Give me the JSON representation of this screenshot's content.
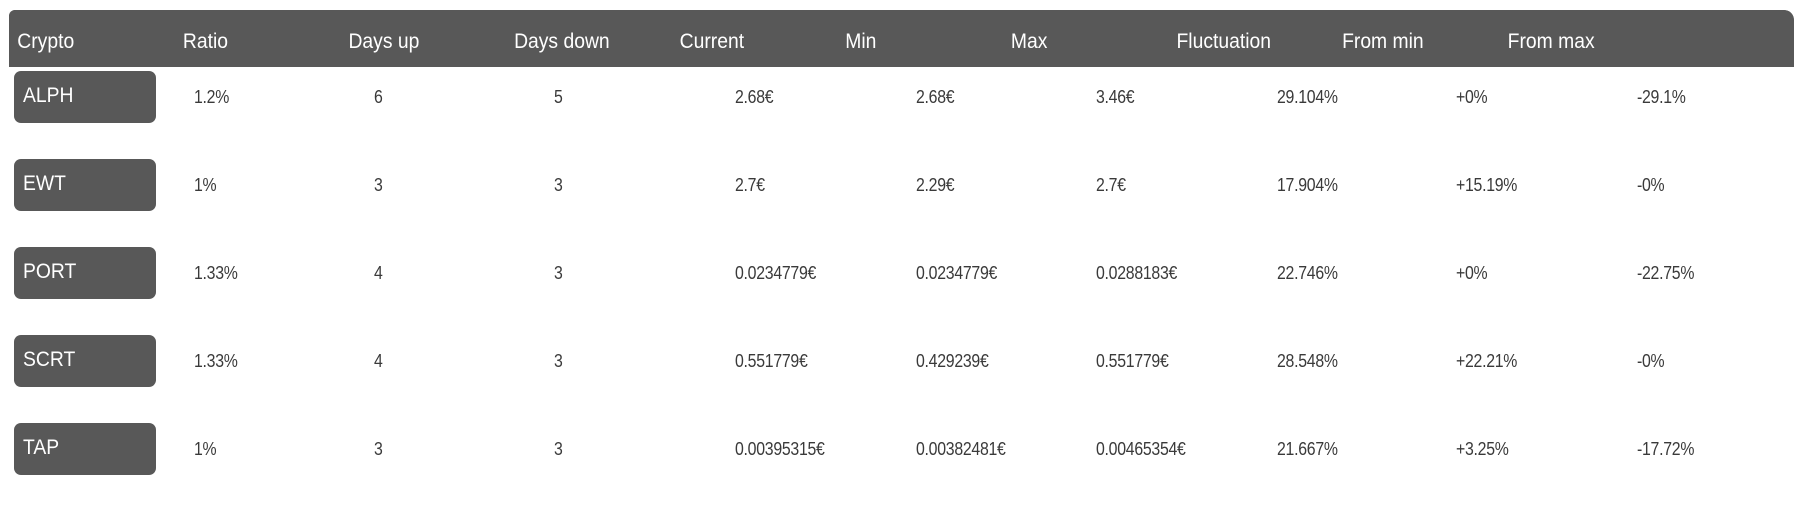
{
  "table": {
    "columns": [
      "Crypto",
      "Ratio",
      "Days up",
      "Days down",
      "Current",
      "Min",
      "Max",
      "Fluctuation",
      "From min",
      "From max"
    ],
    "rows": [
      {
        "crypto": "ALPH",
        "ratio": "1.2%",
        "days_up": "6",
        "days_down": "5",
        "current": "2.68€",
        "min": "2.68€",
        "max": "3.46€",
        "fluctuation": "29.104%",
        "from_min": "+0%",
        "from_max": "-29.1%"
      },
      {
        "crypto": "EWT",
        "ratio": "1%",
        "days_up": "3",
        "days_down": "3",
        "current": "2.7€",
        "min": "2.29€",
        "max": "2.7€",
        "fluctuation": "17.904%",
        "from_min": "+15.19%",
        "from_max": "-0%"
      },
      {
        "crypto": "PORT",
        "ratio": "1.33%",
        "days_up": "4",
        "days_down": "3",
        "current": "0.0234779€",
        "min": "0.0234779€",
        "max": "0.0288183€",
        "fluctuation": "22.746%",
        "from_min": "+0%",
        "from_max": "-22.75%"
      },
      {
        "crypto": "SCRT",
        "ratio": "1.33%",
        "days_up": "4",
        "days_down": "3",
        "current": "0.551779€",
        "min": "0.429239€",
        "max": "0.551779€",
        "fluctuation": "28.548%",
        "from_min": "+22.21%",
        "from_max": "-0%"
      },
      {
        "crypto": "TAP",
        "ratio": "1%",
        "days_up": "3",
        "days_down": "3",
        "current": "0.00395315€",
        "min": "0.00382481€",
        "max": "0.00465354€",
        "fluctuation": "21.667%",
        "from_min": "+3.25%",
        "from_max": "-17.72%"
      }
    ]
  },
  "colors": {
    "header_bg": "#585858",
    "header_text": "#ffffff",
    "pill_bg": "#585858",
    "cell_text": "#3a3a3a",
    "page_bg": "#ffffff"
  }
}
